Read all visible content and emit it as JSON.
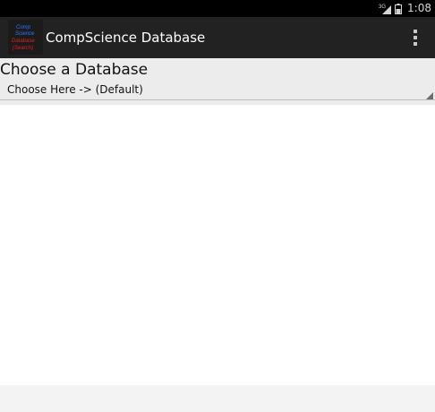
{
  "status_bar": {
    "time": "1:08",
    "network_label": "3G",
    "icons": [
      "signal-icon",
      "battery-icon"
    ]
  },
  "action_bar": {
    "title": "CompScience Database",
    "logo_lines": [
      "Comp",
      "Science",
      "Database",
      "(Search)"
    ],
    "overflow_icon": "overflow-menu-icon"
  },
  "content": {
    "heading": "Choose a Database",
    "spinner_value": "Choose Here -> (Default)"
  },
  "colors": {
    "action_bar": "#222222",
    "status_bar": "#000000",
    "content_band": "#ececec",
    "logo_blue": "#2e74ff",
    "logo_red": "#e81e1e"
  }
}
